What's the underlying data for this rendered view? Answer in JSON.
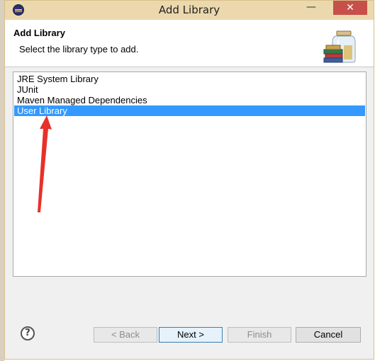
{
  "window": {
    "title": "Add Library",
    "minimize_glyph": "—",
    "close_glyph": "✕"
  },
  "header": {
    "title": "Add Library",
    "description": "Select the library type to add."
  },
  "library_types": [
    {
      "label": "JRE System Library",
      "selected": false
    },
    {
      "label": "JUnit",
      "selected": false
    },
    {
      "label": "Maven Managed Dependencies",
      "selected": false
    },
    {
      "label": "User Library",
      "selected": true
    }
  ],
  "buttons": {
    "help": "?",
    "back": "< Back",
    "next": "Next >",
    "finish": "Finish",
    "cancel": "Cancel"
  },
  "colors": {
    "titlebar": "#ebd8ad",
    "close_button": "#c7504a",
    "selection": "#3399ff",
    "arrow": "#e8302a"
  }
}
